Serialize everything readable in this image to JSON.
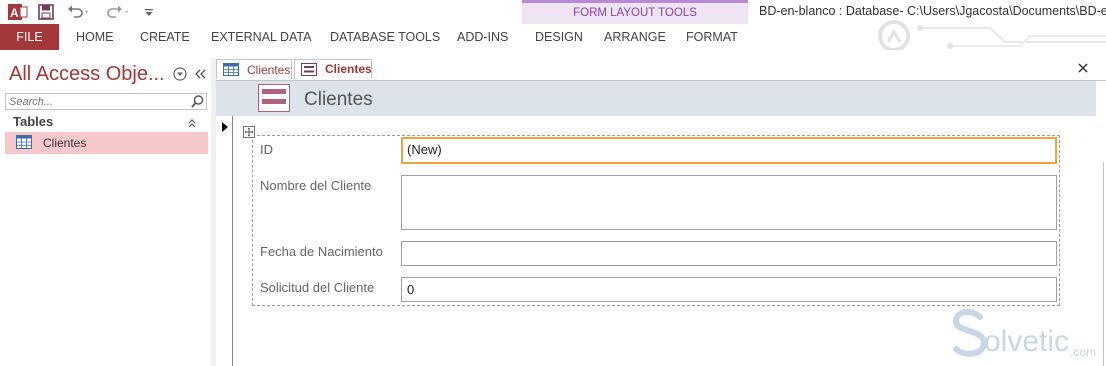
{
  "window": {
    "title": "BD-en-blanco : Database- C:\\Users\\Jgacosta\\Documents\\BD-en-b"
  },
  "ribbon": {
    "contextual_header": "FORM LAYOUT TOOLS",
    "tabs": [
      "FILE",
      "HOME",
      "CREATE",
      "EXTERNAL DATA",
      "DATABASE TOOLS",
      "ADD-INS",
      "DESIGN",
      "ARRANGE",
      "FORMAT"
    ]
  },
  "nav": {
    "title": "All Access Obje...",
    "search_placeholder": "Search...",
    "group": "Tables",
    "items": [
      {
        "label": "Clientes",
        "icon": "table-icon"
      }
    ]
  },
  "document": {
    "tabs": [
      {
        "label": "Clientes",
        "icon": "table-icon",
        "active": false
      },
      {
        "label": "Clientes",
        "icon": "form-icon",
        "active": true
      }
    ],
    "form_title": "Clientes"
  },
  "form": {
    "fields": [
      {
        "label": "ID",
        "value": "(New)"
      },
      {
        "label": "Nombre del Cliente",
        "value": ""
      },
      {
        "label": "Fecha de Nacimiento",
        "value": ""
      },
      {
        "label": "Solicitud del Cliente",
        "value": "0"
      }
    ]
  },
  "watermark": {
    "text": "olvetic",
    "suffix": ".com"
  },
  "colors": {
    "access_red": "#a4373a",
    "contextual_purple": "#8b3fb8",
    "focus_orange": "#f0a43a",
    "nav_selected": "#f7c8ca",
    "form_header": "#dde3ea"
  }
}
